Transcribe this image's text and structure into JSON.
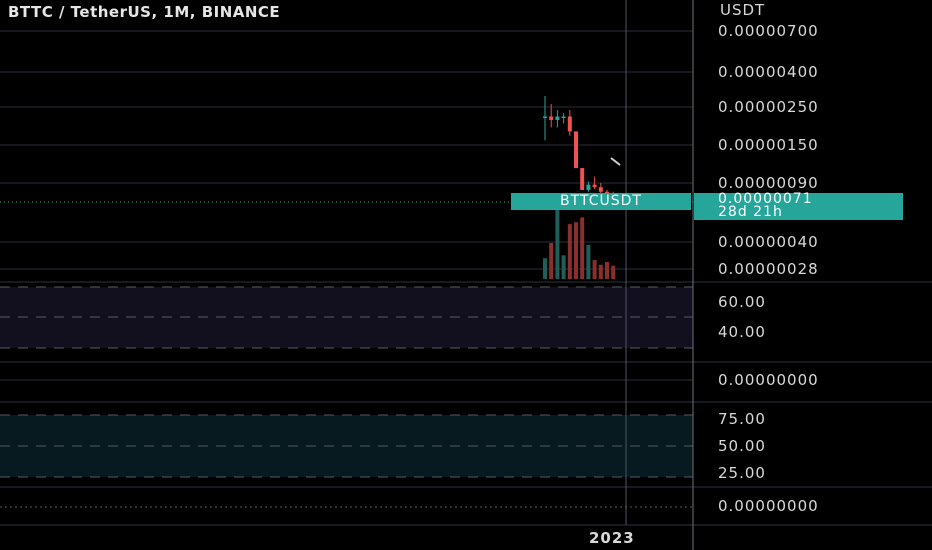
{
  "header": {
    "title": "BTTC / TetherUS, 1M, BINANCE"
  },
  "price_axis": {
    "unit": "USDT",
    "ticks": [
      "0.00000700",
      "0.00000400",
      "0.00000250",
      "0.00000150",
      "0.00000090",
      "0.00000040",
      "0.00000028"
    ]
  },
  "last_price": {
    "symbol": "BTTCUSDT",
    "value": "0.00000071",
    "countdown": "28d 21h"
  },
  "pane2": {
    "ticks": [
      "60.00",
      "40.00"
    ]
  },
  "pane3": {
    "ticks": [
      "0.00000000"
    ]
  },
  "pane4": {
    "ticks": [
      "75.00",
      "50.00",
      "25.00"
    ]
  },
  "pane5": {
    "ticks": [
      "0.00000000"
    ]
  },
  "time_axis": {
    "label": "2023"
  },
  "colors": {
    "up": "#26a69a",
    "down": "#ef5350",
    "bg": "#000000",
    "grid": "#2a2e39"
  },
  "chart_data": {
    "type": "candlestick",
    "title": "BTTC / TetherUS, 1M, BINANCE",
    "y_scale": "log",
    "candles": [
      {
        "o": 2.2e-06,
        "h": 2.9e-06,
        "l": 1.6e-06,
        "c": 2.2e-06
      },
      {
        "o": 2.2e-06,
        "h": 2.6e-06,
        "l": 1.9e-06,
        "c": 2.1e-06
      },
      {
        "o": 2.1e-06,
        "h": 2.4e-06,
        "l": 1.9e-06,
        "c": 2.2e-06
      },
      {
        "o": 2.2e-06,
        "h": 2.3e-06,
        "l": 2e-06,
        "c": 2.2e-06
      },
      {
        "o": 2.2e-06,
        "h": 2.4e-06,
        "l": 1.7e-06,
        "c": 1.8e-06
      },
      {
        "o": 1.8e-06,
        "h": 1.8e-06,
        "l": 1.1e-06,
        "c": 1.1e-06
      },
      {
        "o": 1.1e-06,
        "h": 1.1e-06,
        "l": 8.2e-07,
        "c": 8.2e-07
      },
      {
        "o": 8.2e-07,
        "h": 9.2e-07,
        "l": 8e-07,
        "c": 8.8e-07
      },
      {
        "o": 8.8e-07,
        "h": 9.8e-07,
        "l": 8.3e-07,
        "c": 8.5e-07
      },
      {
        "o": 8.5e-07,
        "h": 9e-07,
        "l": 7.8e-07,
        "c": 8e-07
      },
      {
        "o": 8e-07,
        "h": 8.2e-07,
        "l": 7.5e-07,
        "c": 7.8e-07
      },
      {
        "o": 7.8e-07,
        "h": 8e-07,
        "l": 7e-07,
        "c": 7.1e-07
      }
    ],
    "volume": [
      22,
      38,
      76,
      25,
      58,
      60,
      65,
      36,
      20,
      15,
      18,
      14
    ]
  }
}
